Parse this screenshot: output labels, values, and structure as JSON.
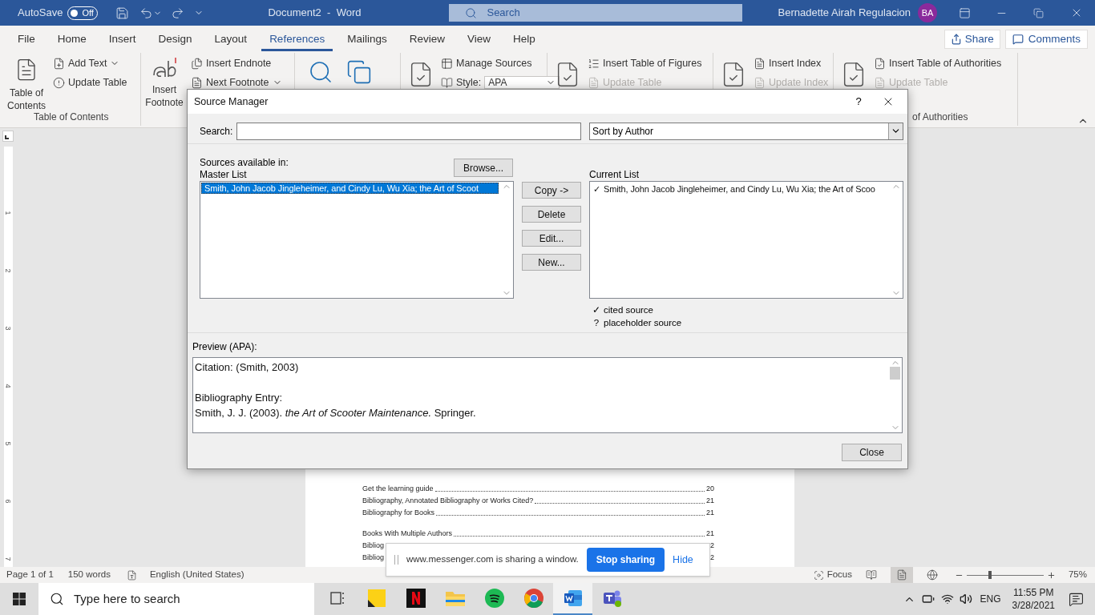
{
  "title_bar": {
    "autosave": {
      "label": "AutoSave",
      "on": false,
      "state_text": "Off"
    },
    "title": "Document2  -  Word",
    "search": {
      "placeholder": "Search"
    },
    "user": "Bernadette Airah Regulacion",
    "avatar": "BA"
  },
  "tabs": [
    {
      "label": "File",
      "selected": false
    },
    {
      "label": "Home",
      "selected": false
    },
    {
      "label": "Insert",
      "selected": false
    },
    {
      "label": "Design",
      "selected": false
    },
    {
      "label": "Layout",
      "selected": false
    },
    {
      "label": "References",
      "selected": true
    },
    {
      "label": "Mailings",
      "selected": false
    },
    {
      "label": "Review",
      "selected": false
    },
    {
      "label": "View",
      "selected": false
    },
    {
      "label": "Help",
      "selected": false
    }
  ],
  "share": "Share",
  "comments": "Comments",
  "ribbon": {
    "groups": [
      {
        "big_label": "Table of Contents",
        "label": "Table of Contents",
        "items": [
          {
            "kind": "button",
            "label": "Add Text",
            "caret": true,
            "disabled": false
          },
          {
            "kind": "button",
            "label": "Update Table",
            "caret": false,
            "disabled": false
          }
        ]
      },
      {
        "big_label": "Insert Footnote",
        "items": [
          {
            "kind": "button",
            "label": "Insert Endnote",
            "caret": false,
            "disabled": false
          },
          {
            "kind": "button",
            "label": "Next Footnote",
            "caret": true,
            "disabled": false
          }
        ]
      },
      {
        "items": [
          {
            "kind": "button",
            "label": "Manage Sources",
            "caret": false,
            "disabled": false
          },
          {
            "kind": "select",
            "label": "Style:",
            "value": "APA",
            "disabled": false
          }
        ]
      },
      {
        "items": [
          {
            "kind": "button",
            "label": "Insert Table of Figures",
            "caret": false,
            "disabled": false
          },
          {
            "kind": "button",
            "label": "Update Table",
            "caret": false,
            "disabled": true
          }
        ]
      },
      {
        "items": [
          {
            "kind": "button",
            "label": "Insert Index",
            "caret": false,
            "disabled": false
          },
          {
            "kind": "button",
            "label": "Update Index",
            "caret": false,
            "disabled": true
          }
        ]
      },
      {
        "label": "of Authorities",
        "items": [
          {
            "kind": "button",
            "label": "Insert Table of Authorities",
            "caret": false,
            "disabled": false
          },
          {
            "kind": "button",
            "label": "Update Table",
            "caret": false,
            "disabled": true
          }
        ]
      }
    ]
  },
  "ruler_numbers": [
    "1",
    "2",
    "3",
    "4",
    "5",
    "6",
    "7"
  ],
  "document": {
    "sections": [
      [
        {
          "title": "Get the learning guide",
          "page": "20"
        },
        {
          "title": "Bibliography, Annotated Bibliography or Works Cited?",
          "page": "21"
        },
        {
          "title": "Bibliography for Books",
          "page": "21"
        }
      ],
      [
        {
          "title": "Books With Multiple Authors",
          "page": "21"
        },
        {
          "title": "Bibliog",
          "page": "2"
        },
        {
          "title": "Bibliog",
          "page": "2"
        }
      ]
    ]
  },
  "dialog": {
    "title": "Source Manager",
    "help": "?",
    "search_label": "Search:",
    "sort": "Sort by Author",
    "sources_label": "Sources available in:",
    "master_label": "Master List",
    "browse": "Browse...",
    "current_label": "Current List",
    "master_list": [
      {
        "text": "Smith, John Jacob Jingleheimer, and Cindy Lu, Wu Xia; the Art of Scoot",
        "selected": true
      }
    ],
    "current_list": [
      {
        "symbol": "✓",
        "text": "Smith, John Jacob Jingleheimer, and Cindy Lu, Wu Xia; the Art of Scoo",
        "selected": false
      }
    ],
    "actions": [
      "Copy ->",
      "Delete",
      "Edit...",
      "New..."
    ],
    "legend": [
      {
        "symbol": "✓",
        "text": "cited source"
      },
      {
        "symbol": "?",
        "text": "placeholder source"
      }
    ],
    "preview_label": "Preview (APA):",
    "preview_lines": [
      "Citation:  (Smith, 2003)",
      "Bibliography Entry:",
      "Smith, J. J. (2003). *the Art of Scooter Maintenance.* Springer."
    ],
    "close": "Close"
  },
  "status_bar": {
    "page": "Page 1 of 1",
    "words": "150 words",
    "language": "English (United States)",
    "focus": "Focus",
    "views": [
      {
        "selected": false
      },
      {
        "selected": true
      },
      {
        "selected": false
      }
    ],
    "zoom": {
      "level": 0.3
    },
    "zoom_text": "75%"
  },
  "sharing_bar": {
    "message": "www.messenger.com is sharing a window.",
    "stop": "Stop sharing",
    "hide": "Hide"
  },
  "taskbar": {
    "search_placeholder": "Type here to search",
    "apps": [
      {
        "selected": false
      },
      {
        "selected": false
      },
      {
        "selected": false
      },
      {
        "selected": false
      },
      {
        "selected": false
      },
      {
        "selected": false
      },
      {
        "selected": true
      },
      {
        "selected": false
      }
    ],
    "language": "ENG",
    "time": "11:55 PM",
    "date": "3/28/2021"
  }
}
